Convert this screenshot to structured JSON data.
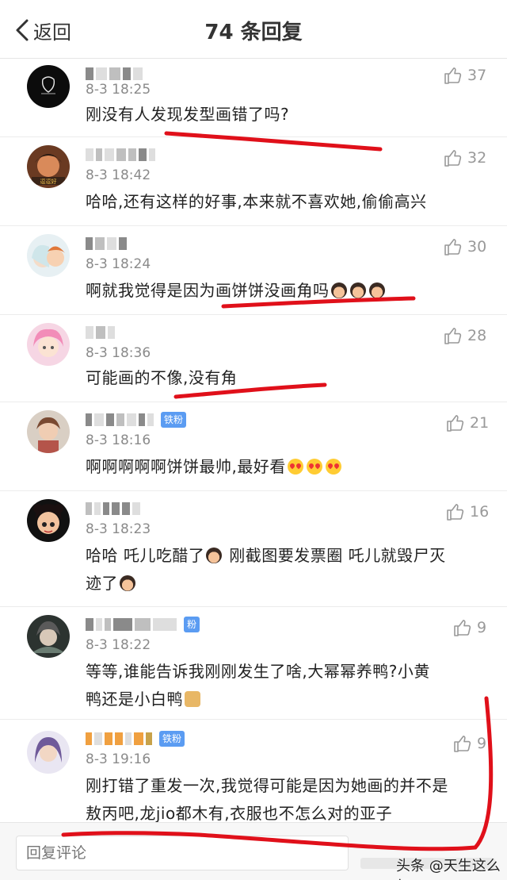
{
  "header": {
    "back_label": "返回",
    "title": "74 条回复"
  },
  "comments": [
    {
      "time": "8-3 18:25",
      "text": "刚没有人发现发型画错了吗?",
      "likes": "37"
    },
    {
      "time": "8-3 18:42",
      "text": "哈哈,还有这样的好事,本来就不喜欢她,偷偷高兴",
      "likes": "32"
    },
    {
      "time": "8-3 18:24",
      "text": "啊就我觉得是因为画饼饼没画角吗",
      "likes": "30"
    },
    {
      "time": "8-3 18:36",
      "text": "可能画的不像,没有角",
      "likes": "28"
    },
    {
      "time": "8-3 18:16",
      "text": "啊啊啊啊啊饼饼最帅,最好看",
      "likes": "21",
      "badge": "铁粉"
    },
    {
      "time": "8-3 18:23",
      "text": "哈哈 吒儿吃醋了",
      "text2": "刚截图要发票圈 吒儿就毁尸灭",
      "text3": "迹了",
      "likes": "16"
    },
    {
      "time": "8-3 18:22",
      "text": "等等,谁能告诉我刚刚发生了啥,大幂幂养鸭?小黄",
      "text2": "鸭还是小白鸭",
      "likes": "9",
      "badge": "粉"
    },
    {
      "time": "8-3 19:16",
      "text": "刚打错了重发一次,我觉得可能是因为她画的并不是",
      "text2": "敖丙吧,龙jio都木有,衣服也不怎么对的亚子",
      "likes": "9",
      "badge": "铁粉"
    }
  ],
  "footer": {
    "reply_placeholder": "回复评论",
    "watermark": "头条 @天生这么红"
  },
  "colors": {
    "annotation_red": "#e0101a",
    "badge_blue": "#5b9cf2"
  },
  "icons": [
    "back-chevron-icon",
    "thumbs-up-icon"
  ]
}
